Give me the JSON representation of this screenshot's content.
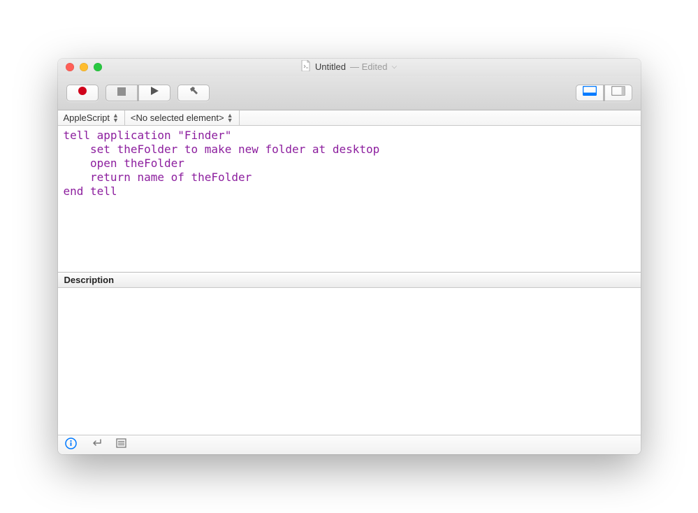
{
  "title": {
    "name": "Untitled",
    "status": "— Edited"
  },
  "toolbar": {
    "record": "Record",
    "stop": "Stop",
    "run": "Run",
    "compile": "Compile"
  },
  "nav": {
    "language": "AppleScript",
    "element": "<No selected element>"
  },
  "code": "tell application \"Finder\"\n    set theFolder to make new folder at desktop\n    open theFolder\n    return name of theFolder\nend tell",
  "description": {
    "header": "Description",
    "text": ""
  },
  "icons": {
    "record": "record-icon",
    "stop": "stop-icon",
    "run": "play-icon",
    "compile": "hammer-icon",
    "view_log": "window-with-panel-icon",
    "view_desc": "window-with-sidebar-icon",
    "info": "info-icon",
    "return": "return-icon",
    "list": "list-icon"
  }
}
